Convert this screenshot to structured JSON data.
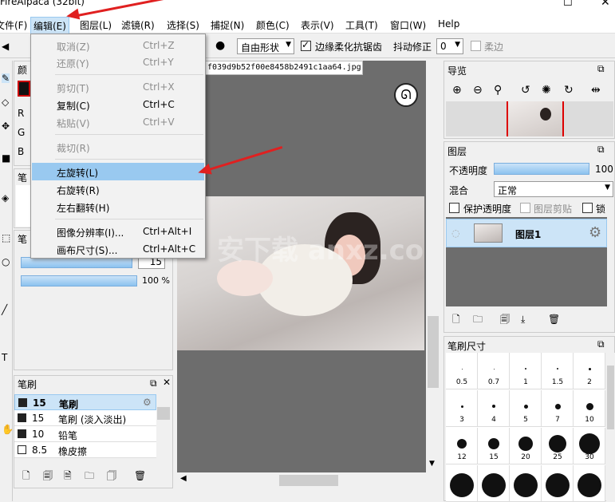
{
  "window": {
    "title": "FireAlpaca (32bit)"
  },
  "menu": {
    "items": [
      "文件(F)",
      "编辑(E)",
      "图层(L)",
      "滤镜(R)",
      "选择(S)",
      "捕捉(N)",
      "颜色(C)",
      "表示(V)",
      "工具(T)",
      "窗口(W)",
      "Help"
    ]
  },
  "toolbar": {
    "shape_select": "自由形状",
    "antialias_label": "边缘柔化抗锯齿",
    "stabilizer_label": "抖动修正",
    "stabilizer_value": "0",
    "soft_edge_label": "柔边"
  },
  "edit_menu": {
    "undo": {
      "label": "取消(Z)",
      "shortcut": "Ctrl+Z"
    },
    "redo": {
      "label": "还原(Y)",
      "shortcut": "Ctrl+Y"
    },
    "cut": {
      "label": "剪切(T)",
      "shortcut": "Ctrl+X"
    },
    "copy": {
      "label": "复制(C)",
      "shortcut": "Ctrl+C"
    },
    "paste": {
      "label": "粘贴(V)",
      "shortcut": "Ctrl+V"
    },
    "crop": {
      "label": "裁切(R)"
    },
    "rotate_left": {
      "label": "左旋转(L)"
    },
    "rotate_right": {
      "label": "右旋转(R)"
    },
    "flip_horizontal": {
      "label": "左右翻转(H)"
    },
    "image_resolution": {
      "label": "图像分辨率(I)...",
      "shortcut": "Ctrl+Alt+I"
    },
    "canvas_size": {
      "label": "画布尺寸(S)...",
      "shortcut": "Ctrl+Alt+C"
    }
  },
  "document": {
    "tab_title": "f039d9b52f00e8458b2491c1aa64.jpg",
    "watermark": "安下载 anxz.com"
  },
  "left_panels": {
    "color_title": "颜",
    "color_r": "R",
    "color_g": "G",
    "color_b": "B",
    "brush_title_a": "笔",
    "brush_title_b": "笔",
    "brush_size_value": "15",
    "brush_opacity_value": "100 %"
  },
  "brush_panel": {
    "title": "笔刷",
    "items": [
      {
        "size": "15",
        "name": "笔刷"
      },
      {
        "size": "15",
        "name": "笔刷 (淡入淡出)"
      },
      {
        "size": "10",
        "name": "铅笔"
      },
      {
        "size": "8.5",
        "name": "橡皮擦"
      }
    ]
  },
  "navigator": {
    "title": "导览"
  },
  "layers": {
    "title": "图层",
    "opacity_label": "不透明度",
    "opacity_value": "100",
    "blend_label": "混合",
    "blend_value": "正常",
    "protect_alpha": "保护透明度",
    "clipping": "图层剪贴",
    "lock": "锁定",
    "layer_name": "图层1"
  },
  "brush_size": {
    "title": "笔刷尺寸",
    "sizes": [
      "0.5",
      "0.7",
      "1",
      "1.5",
      "2",
      "3",
      "4",
      "5",
      "7",
      "10",
      "12",
      "15",
      "20",
      "25",
      "30"
    ]
  },
  "colors": {
    "accent": "#99c9f0",
    "selection": "#cce4f7",
    "arrow": "#e02020"
  }
}
